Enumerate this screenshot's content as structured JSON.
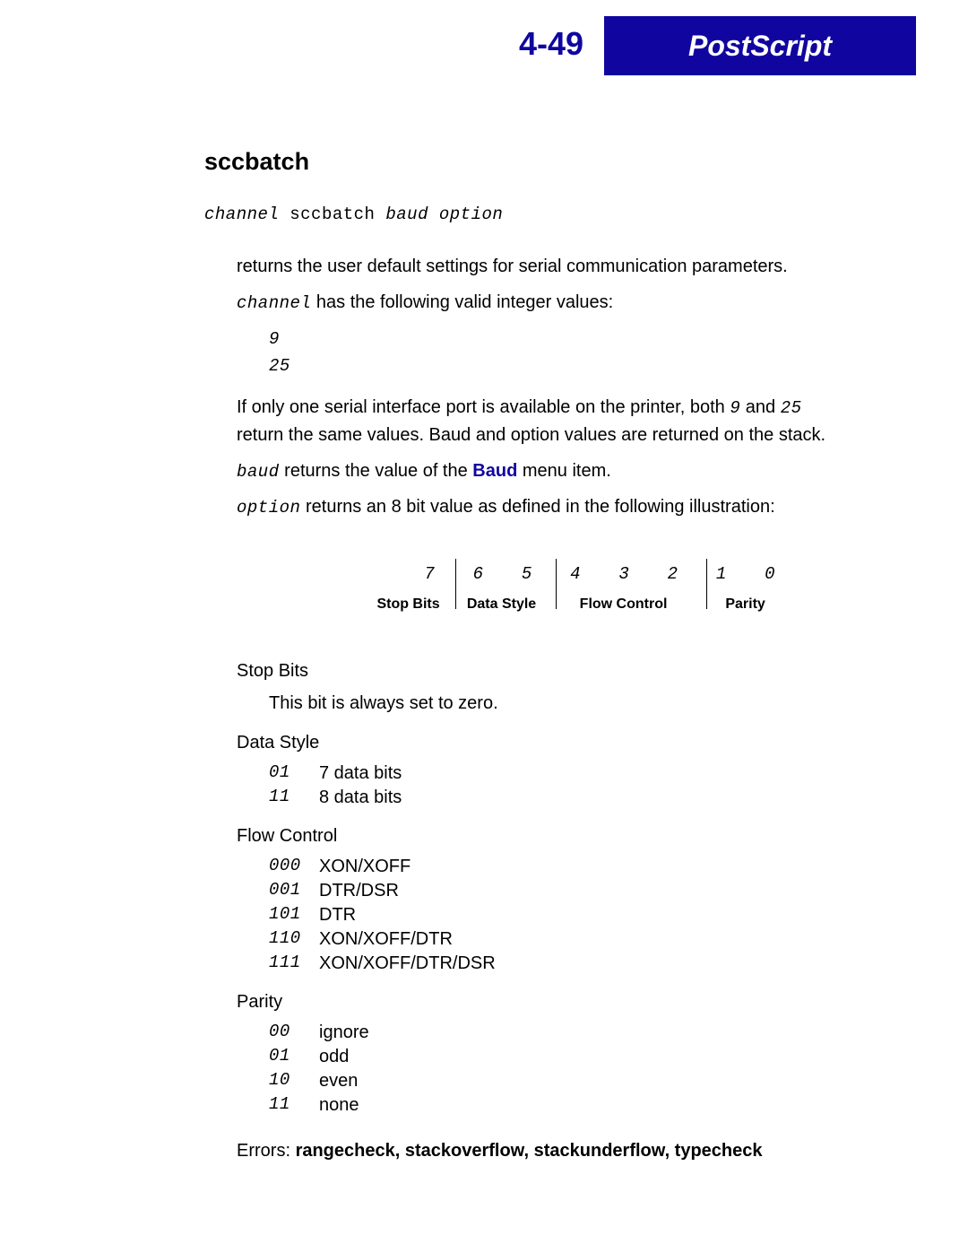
{
  "header": {
    "page_number": "4-49",
    "section_title": "PostScript"
  },
  "command": {
    "name": "sccbatch",
    "signature_args_pre": "channel",
    "signature_cmd": "sccbatch",
    "signature_args_post": "baud option"
  },
  "paragraphs": {
    "intro": "returns the user default settings for serial communication parameters.",
    "channel_param": "channel",
    "channel_text": " has the following valid integer values:",
    "channel_values": [
      "9",
      "25"
    ],
    "single_port": "If only one serial interface port is available on the printer, both ",
    "single_port_v1": "9",
    "single_port_mid": " and ",
    "single_port_v2": "25",
    "single_port_end": " return the same values. Baud and option values are returned on the stack.",
    "baud_param": "baud",
    "baud_text_pre": " returns the value of the ",
    "baud_menu": "Baud",
    "baud_text_post": " menu item.",
    "option_param": "option",
    "option_text": " returns an 8 bit value as defined in the following illustration:"
  },
  "bitfield": {
    "bits": [
      "7",
      "6",
      "5",
      "4",
      "3",
      "2",
      "1",
      "0"
    ],
    "labels": [
      "Stop Bits",
      "Data Style",
      "Flow Control",
      "Parity"
    ]
  },
  "definitions": {
    "stopbits": {
      "term": "Stop Bits",
      "desc": "This bit is always set to zero."
    },
    "datastyle": {
      "term": "Data Style",
      "rows": [
        {
          "code": "01",
          "val": "7 data bits"
        },
        {
          "code": "11",
          "val": "8 data bits"
        }
      ]
    },
    "flowcontrol": {
      "term": "Flow Control",
      "rows": [
        {
          "code": "000",
          "val": "XON/XOFF"
        },
        {
          "code": "001",
          "val": "DTR/DSR"
        },
        {
          "code": "101",
          "val": "DTR"
        },
        {
          "code": "110",
          "val": "XON/XOFF/DTR"
        },
        {
          "code": "111",
          "val": "XON/XOFF/DTR/DSR"
        }
      ]
    },
    "parity": {
      "term": "Parity",
      "rows": [
        {
          "code": "00",
          "val": "ignore"
        },
        {
          "code": "01",
          "val": "odd"
        },
        {
          "code": "10",
          "val": "even"
        },
        {
          "code": "11",
          "val": "none"
        }
      ]
    }
  },
  "errors": {
    "label": "Errors: ",
    "list": "rangecheck, stackoverflow, stackunderflow, typecheck"
  }
}
